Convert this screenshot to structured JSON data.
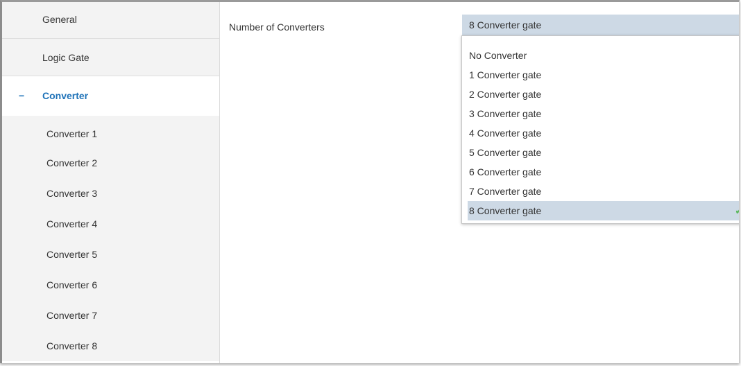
{
  "sidebar": {
    "items": [
      {
        "label": "General"
      },
      {
        "label": "Logic Gate"
      },
      {
        "label": "Converter",
        "active_marker": "−"
      }
    ],
    "sub_items": [
      {
        "label": "Converter 1"
      },
      {
        "label": "Converter 2"
      },
      {
        "label": "Converter 3"
      },
      {
        "label": "Converter 4"
      },
      {
        "label": "Converter 5"
      },
      {
        "label": "Converter 6"
      },
      {
        "label": "Converter 7"
      },
      {
        "label": "Converter 8"
      }
    ]
  },
  "main": {
    "field_label": "Number of Converters",
    "select": {
      "value": "8 Converter gate",
      "options": [
        "No Converter",
        "1 Converter gate",
        "2 Converter gate",
        "3 Converter gate",
        "4 Converter gate",
        "5 Converter gate",
        "6 Converter gate",
        "7 Converter gate",
        "8 Converter gate"
      ],
      "selected_index": 8,
      "check_glyph": "✔"
    }
  },
  "colors": {
    "accent": "#1e72b8",
    "selection": "#cdd9e5",
    "check": "#5cb85c"
  }
}
